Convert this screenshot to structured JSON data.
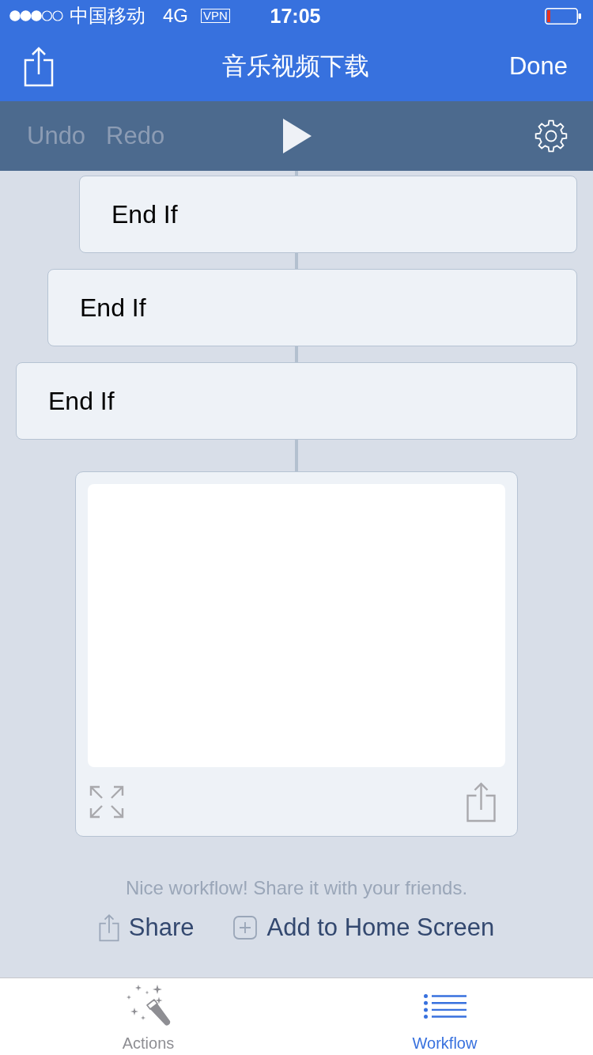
{
  "status_bar": {
    "carrier": "中国移动",
    "network": "4G",
    "vpn": "VPN",
    "time": "17:05"
  },
  "nav_bar": {
    "title": "音乐视频下载",
    "done_button": "Done"
  },
  "toolbar": {
    "buttons": [
      {
        "label": "Undo",
        "disabled": true
      },
      {
        "label": "Redo",
        "disabled": true
      }
    ]
  },
  "workflow": {
    "blocks": [
      {
        "end_label": "End If",
        "children": [
          {
            "end_label": "End If",
            "children": [
              {
                "end_label": "End If"
              }
            ]
          }
        ]
      }
    ]
  },
  "share_prompt": {
    "message": "Nice workflow! Share it with your friends.",
    "actions": [
      {
        "kind": "share",
        "label": "Share"
      },
      {
        "kind": "add",
        "label": "Add to Home Screen"
      }
    ]
  },
  "tab_bar": {
    "tabs": [
      {
        "kind": "actions",
        "label": "Actions",
        "selected": false
      },
      {
        "kind": "workflow",
        "label": "Workflow",
        "selected": true
      }
    ]
  }
}
